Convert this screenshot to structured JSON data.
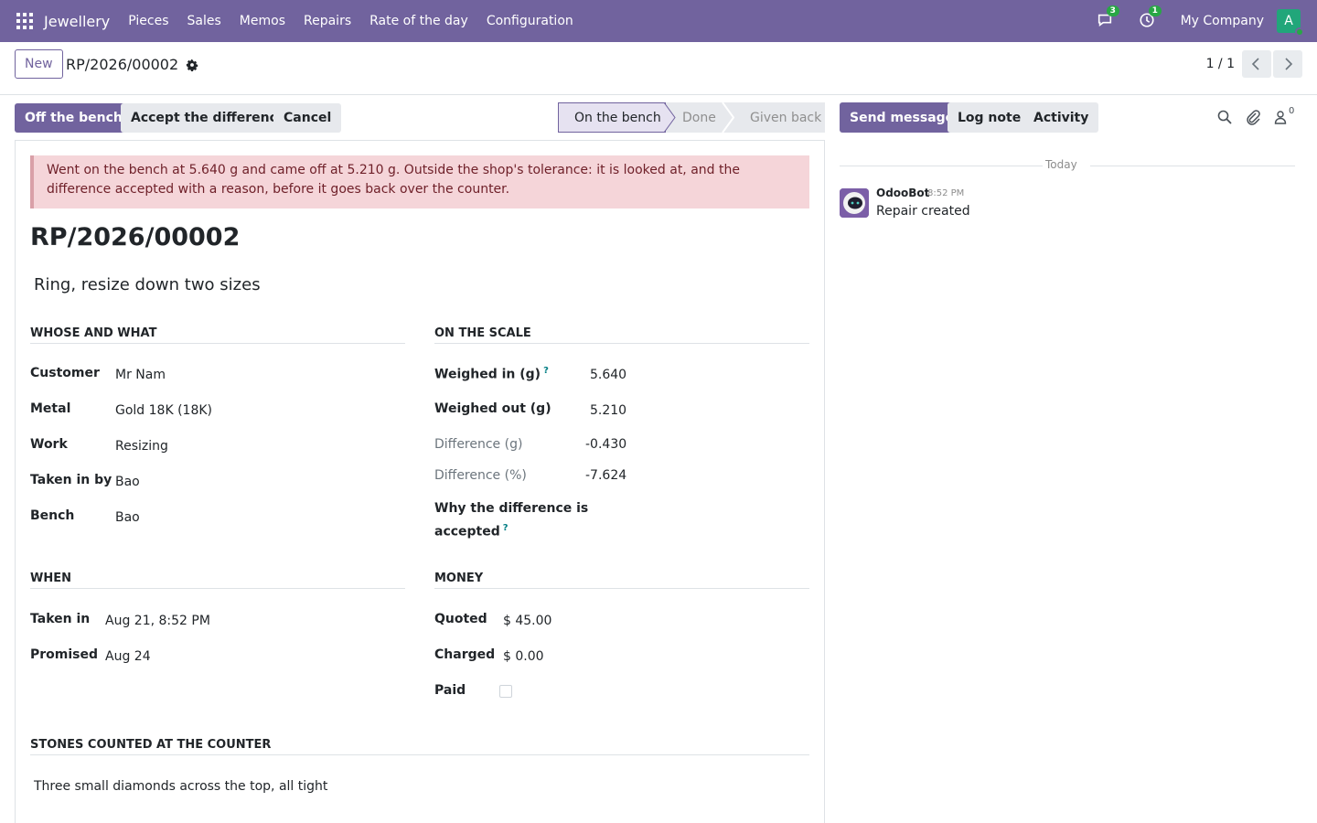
{
  "navbar": {
    "app_name": "Jewellery",
    "menu": [
      "Pieces",
      "Sales",
      "Memos",
      "Repairs",
      "Rate of the day",
      "Configuration"
    ],
    "messages_count": "3",
    "activities_count": "1",
    "company": "My Company",
    "avatar_letter": "A",
    "color": "#71639e"
  },
  "control_panel": {
    "new_label": "New",
    "breadcrumb": "RP/2026/00002",
    "pager": "1 / 1"
  },
  "actions": {
    "off_bench": "Off the bench",
    "accept_difference": "Accept the difference",
    "cancel": "Cancel"
  },
  "statusbar": {
    "stages": [
      "On the bench",
      "Done",
      "Given back"
    ],
    "active": "On the bench"
  },
  "alert": "Went on the bench at 5.640 g and came off at 5.210 g. Outside the shop's tolerance: it is looked at, and the difference accepted with a reason, before it goes back over the counter.",
  "record": {
    "reference": "RP/2026/00002",
    "description": "Ring, resize down two sizes"
  },
  "whose_and_what": {
    "title": "Whose and what",
    "fields": [
      {
        "label": "Customer",
        "value": "Mr Nam"
      },
      {
        "label": "Metal",
        "value": "Gold 18K (18K)"
      },
      {
        "label": "Work",
        "value": "Resizing"
      },
      {
        "label": "Taken in by",
        "value": "Bao"
      },
      {
        "label": "Bench",
        "value": "Bao"
      }
    ]
  },
  "on_the_scale": {
    "title": "On the scale",
    "weighed_in_label": "Weighed in (g)",
    "weighed_in": "5.640",
    "weighed_out_label": "Weighed out (g)",
    "weighed_out": "5.210",
    "difference_g_label": "Difference (g)",
    "difference_g": "-0.430",
    "difference_pct_label": "Difference (%)",
    "difference_pct": "-7.624",
    "reason_label_1": "Why the difference is",
    "reason_label_2": "accepted",
    "help_mark": "?"
  },
  "when": {
    "title": "When",
    "taken_in_label": "Taken in",
    "taken_in": "Aug 21, 8:52 PM",
    "promised_label": "Promised",
    "promised": "Aug 24"
  },
  "money": {
    "title": "Money",
    "quoted_label": "Quoted",
    "quoted": "$ 45.00",
    "charged_label": "Charged",
    "charged": "$ 0.00",
    "paid_label": "Paid",
    "paid": false
  },
  "stones": {
    "title": "Stones counted at the counter",
    "text": "Three small diamonds across the top, all tight"
  },
  "chatter": {
    "send_message": "Send message",
    "log_note": "Log note",
    "activity": "Activity",
    "followers_count": "0",
    "day_label": "Today",
    "message": {
      "author": "OdooBot",
      "time": "8:52 PM",
      "body": "Repair created"
    }
  }
}
